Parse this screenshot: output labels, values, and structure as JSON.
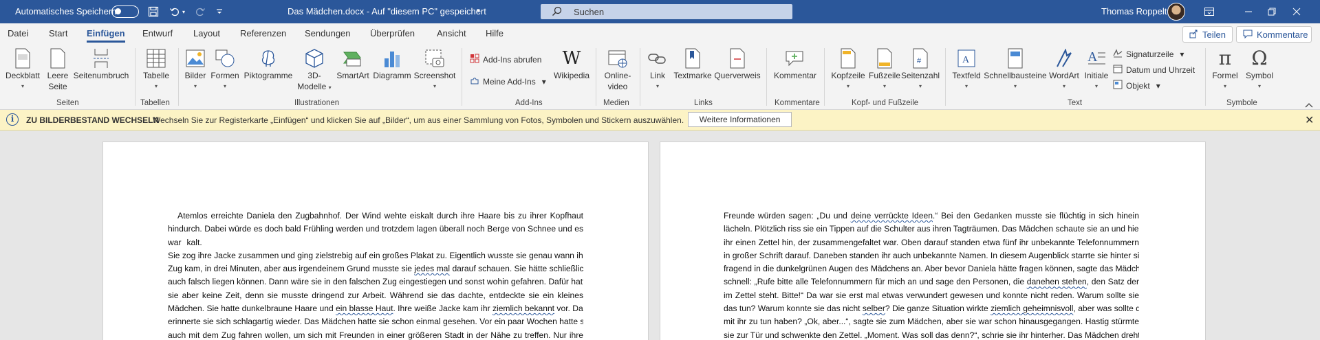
{
  "titlebar": {
    "autosave_label": "Automatisches Speichern",
    "autosave_state": "off",
    "document_title": "Das Mädchen.docx  -  Auf \"diesem PC\" gespeichert",
    "search_placeholder": "Suchen",
    "user_name": "Thomas Roppelt"
  },
  "tabs": [
    "Datei",
    "Start",
    "Einfügen",
    "Entwurf",
    "Layout",
    "Referenzen",
    "Sendungen",
    "Überprüfen",
    "Ansicht",
    "Hilfe"
  ],
  "active_tab": "Einfügen",
  "actions": {
    "share": "Teilen",
    "comments": "Kommentare"
  },
  "ribbon": {
    "groups": {
      "seiten": "Seiten",
      "tabellen": "Tabellen",
      "illustrationen": "Illustrationen",
      "addins": "Add-Ins",
      "medien": "Medien",
      "links": "Links",
      "kommentare": "Kommentare",
      "kopf": "Kopf- und Fußzeile",
      "text": "Text",
      "symbole": "Symbole"
    },
    "buttons": {
      "deckblatt": "Deckblatt",
      "leere_seite_1": "Leere",
      "leere_seite_2": "Seite",
      "seitenumbruch": "Seitenumbruch",
      "tabelle": "Tabelle",
      "bilder": "Bilder",
      "formen": "Formen",
      "piktogramme": "Piktogramme",
      "modelle_1": "3D-",
      "modelle_2": "Modelle",
      "smartart": "SmartArt",
      "diagramm": "Diagramm",
      "screenshot": "Screenshot",
      "addins_abrufen": "Add-Ins abrufen",
      "meine_addins": "Meine Add-Ins",
      "wikipedia": "Wikipedia",
      "onlinevideo_1": "Online-",
      "onlinevideo_2": "video",
      "link": "Link",
      "textmarke": "Textmarke",
      "querverweis": "Querverweis",
      "kommentar": "Kommentar",
      "kopfzeile": "Kopfzeile",
      "fusszeile": "Fußzeile",
      "seitenzahl": "Seitenzahl",
      "textfeld": "Textfeld",
      "schnellbausteine": "Schnellbausteine",
      "wordart": "WordArt",
      "initiale": "Initiale",
      "signaturzeile": "Signaturzeile",
      "datum_uhrzeit": "Datum und Uhrzeit",
      "objekt": "Objekt",
      "formel": "Formel",
      "symbol": "Symbol"
    }
  },
  "infobar": {
    "title": "ZU BILDERBESTAND WECHSELN",
    "message": "Wechseln Sie zur Registerkarte „Einfügen“ und klicken Sie auf „Bilder“, um aus einer Sammlung von Fotos, Symbolen und Stickern auszuwählen.",
    "button": "Weitere Informationen"
  },
  "page1": {
    "lines": [
      "Atemlos erreichte Daniela den Zugbahnhof. Der Wind wehte eiskalt durch ihre Haare bis zu ihrer Kopfhaut",
      "hindurch. Dabei würde es doch bald Frühling werden und trotzdem lagen überall noch Berge von Schnee und es",
      "war",
      "kalt.",
      "Sie zog ihre Jacke zusammen und ging zielstrebig auf ein großes Plakat zu. Eigentlich wusste sie genau wann ihr",
      "Zug kam, in drei Minuten, aber aus irgendeinem Grund musste sie",
      "jedes mal",
      "darauf schauen. Sie hätte schließlich",
      "auch falsch liegen können. Dann wäre sie in den falschen Zug eingestiegen und sonst wohin gefahren. Dafür hatte",
      "sie aber keine Zeit, denn sie musste dringend zur Arbeit. Während sie das dachte, entdeckte sie ein kleines",
      "Mädchen. Sie hatte dunkelbraune Haare und",
      "ein blasse Haut",
      ". Ihre weiße Jacke kam ihr",
      "ziemlich bekannt",
      "vor. Dann",
      "erinnerte sie sich schlagartig wieder. Das Mädchen hatte sie schon einmal gesehen. Vor ein paar Wochen hatte sie",
      "auch mit dem Zug fahren wollen, um sich mit Freunden in einer größeren Stadt in der Nähe zu treffen. Nur ihre"
    ]
  },
  "page2": {
    "lines": [
      "Freunde würden sagen: „Du und",
      "deine verrückte Ideen",
      ".“ Bei den Gedanken musste sie flüchtig in sich hinein",
      "lächeln. Plötzlich riss sie ein Tippen auf die Schulter aus ihren Tagträumen. Das Mädchen schaute sie an und hielt",
      "ihr einen Zettel hin, der zusammengefaltet war. Oben darauf standen etwa fünf ihr unbekannte Telefonnummern",
      "in großer Schrift darauf. Daneben standen ihr auch unbekannte Namen. In diesem Augenblick starrte sie hinter sich",
      "fragend in die dunkelgrünen Augen des Mädchens an. Aber bevor Daniela hätte fragen können, sagte das Mädchen",
      "schnell: „Rufe bitte alle Telefonnummern für mich an und sage den Personen, die",
      "danehen stehen",
      ", den Satz der",
      "im Zettel steht. Bitte!“ Da war sie erst mal etwas verwundert gewesen und konnte nicht reden. Warum sollte sie",
      "das tun? Warum konnte sie das nicht",
      "selber",
      "? Die ganze Situation wirkte",
      "ziemlich geheimnisvoll",
      ", aber was sollte das",
      "mit ihr zu tun haben? „Ok, aber...“, sagte sie zum Mädchen, aber sie war schon hinausgegangen. Hastig stürmte",
      "sie zur Tür und schwenkte den Zettel. „Moment. Was soll das denn?“, schrie sie ihr hinterher. Das Mädchen drehte"
    ]
  },
  "colors": {
    "accent": "#2b579a",
    "infobar_bg": "#fcf3c5",
    "ribbon_bg": "#f3f3f3"
  }
}
